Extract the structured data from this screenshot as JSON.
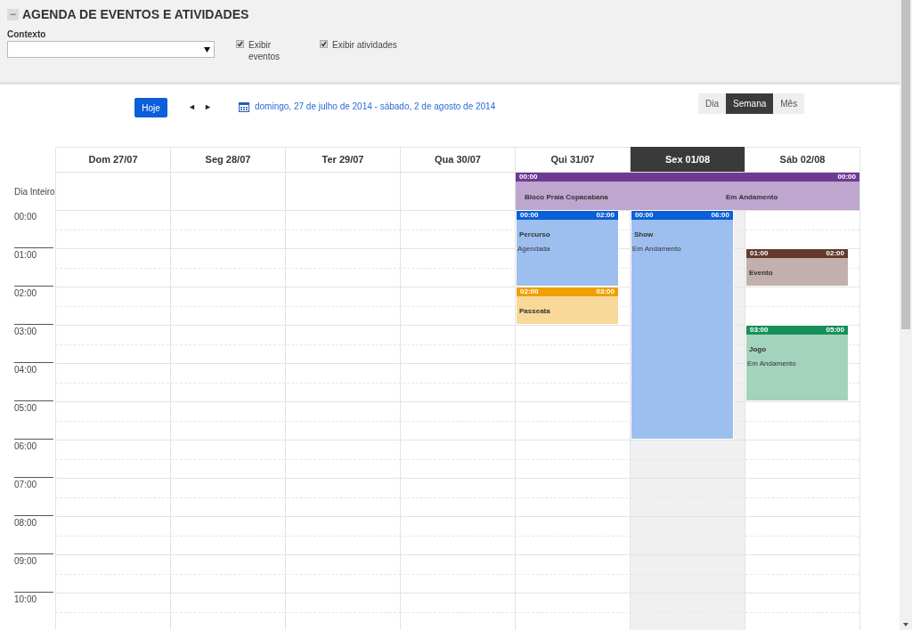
{
  "panel": {
    "title": "AGENDA DE EVENTOS E ATIVIDADES",
    "collapse_icon": "−",
    "context_label": "Contexto",
    "checkboxes": [
      {
        "label": "Exibir eventos",
        "checked": true
      },
      {
        "label": "Exibir atividades",
        "checked": true
      }
    ]
  },
  "toolbar": {
    "today_button": "Hoje",
    "prev": "◄",
    "next": "►",
    "date_range": "domingo, 27 de julho de 2014 - sábado, 2 de agosto de 2014",
    "views": [
      {
        "label": "Dia",
        "selected": false
      },
      {
        "label": "Semana",
        "selected": true
      },
      {
        "label": "Mês",
        "selected": false
      }
    ]
  },
  "calendar": {
    "all_day_label": "Dia Inteiro",
    "hours": [
      "00:00",
      "01:00",
      "02:00",
      "03:00",
      "04:00",
      "05:00",
      "06:00",
      "07:00",
      "08:00",
      "09:00",
      "10:00"
    ],
    "days": [
      {
        "label": "Dom 27/07",
        "selected": false
      },
      {
        "label": "Seg 28/07",
        "selected": false
      },
      {
        "label": "Ter 29/07",
        "selected": false
      },
      {
        "label": "Qua 30/07",
        "selected": false
      },
      {
        "label": "Qui 31/07",
        "selected": false,
        "all_day_events": [
          {
            "start": "00:00",
            "end": "00:00",
            "title": "Bloco Praia Copacabana",
            "status": "Em Andamento",
            "color": "#6f3a94"
          }
        ],
        "events": [
          {
            "start": "00:00",
            "end": "02:00",
            "title": "Percurso",
            "status": "Agendada",
            "color": "#0b5fd8"
          },
          {
            "start": "02:00",
            "end": "03:00",
            "title": "Passeata",
            "color": "#f0a000"
          }
        ]
      },
      {
        "label": "Sex 01/08",
        "selected": true,
        "events": [
          {
            "start": "00:00",
            "end": "06:00",
            "title": "Show",
            "status": "Em Andamento",
            "color": "#0b5fd8"
          }
        ]
      },
      {
        "label": "Sáb 02/08",
        "selected": false,
        "events": [
          {
            "start": "01:00",
            "end": "02:00",
            "title": "Evento",
            "color": "#633a2c"
          },
          {
            "start": "03:00",
            "end": "05:00",
            "title": "Jogo",
            "status": "Em Andamento",
            "color": "#16915a"
          }
        ]
      }
    ]
  }
}
